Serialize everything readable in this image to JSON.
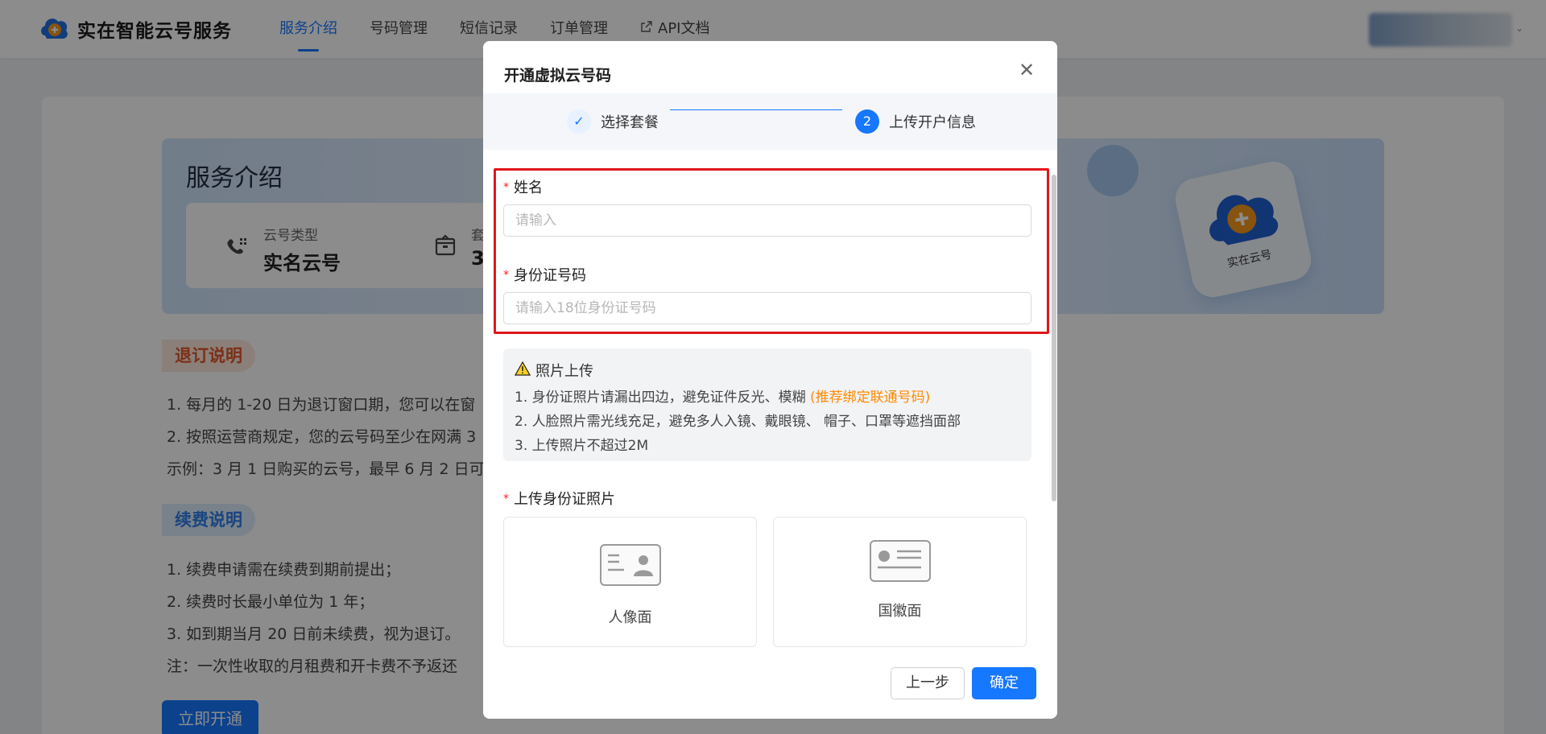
{
  "app": {
    "brand_name": "实在智能云号服务",
    "colors": {
      "primary": "#1677ff",
      "required": "#f5222d",
      "highlight": "#e0161d",
      "warning_link": "#ff8a00"
    }
  },
  "nav": {
    "items": [
      {
        "label": "服务介绍",
        "active": true
      },
      {
        "label": "号码管理"
      },
      {
        "label": "短信记录"
      },
      {
        "label": "订单管理"
      },
      {
        "label": "API文档",
        "icon": "external-link-icon"
      }
    ]
  },
  "page": {
    "hero_title": "服务介绍",
    "info": [
      {
        "key": "云号类型",
        "value": "实名云号",
        "icon": "phone-grid-icon"
      },
      {
        "key": "套",
        "value": "3",
        "icon": "package-icon"
      }
    ],
    "hero_art_label": "实在云号",
    "refund_tag": "退订说明",
    "refund_lines": [
      "1. 每月的 1-20 日为退订窗口期，您可以在窗",
      "2. 按照运营商规定，您的云号码至少在网满 3",
      "示例：3 月 1 日购买的云号，最早 6 月 2 日可"
    ],
    "renew_tag": "续费说明",
    "renew_lines": [
      "1. 续费申请需在续费到期前提出；",
      "2. 续费时长最小单位为 1 年；",
      "3. 如到期当月 20 日前未续费，视为退订。",
      "注：一次性收取的月租费和开卡费不予返还"
    ],
    "open_button": "立即开通"
  },
  "modal": {
    "title": "开通虚拟云号码",
    "steps": [
      {
        "label": "选择套餐",
        "icon": "check-icon",
        "mark": "✓"
      },
      {
        "label": "上传开户信息",
        "number": "2"
      }
    ],
    "name_label": "姓名",
    "name_placeholder": "请输入",
    "id_label": "身份证号码",
    "id_placeholder": "请输入18位身份证号码",
    "notice": {
      "title": "照片上传",
      "line1": "1. 身份证照片请漏出四边，避免证件反光、模糊 ",
      "line1_link": "(推荐绑定联通号码)",
      "line2": "2. 人脸照片需光线充足，避免多人入镜、戴眼镜、 帽子、口罩等遮挡面部",
      "line3": "3. 上传照片不超过2M"
    },
    "upload_label": "上传身份证照片",
    "upload_front": "人像面",
    "upload_back": "国徽面",
    "prev_button": "上一步",
    "ok_button": "确定"
  }
}
